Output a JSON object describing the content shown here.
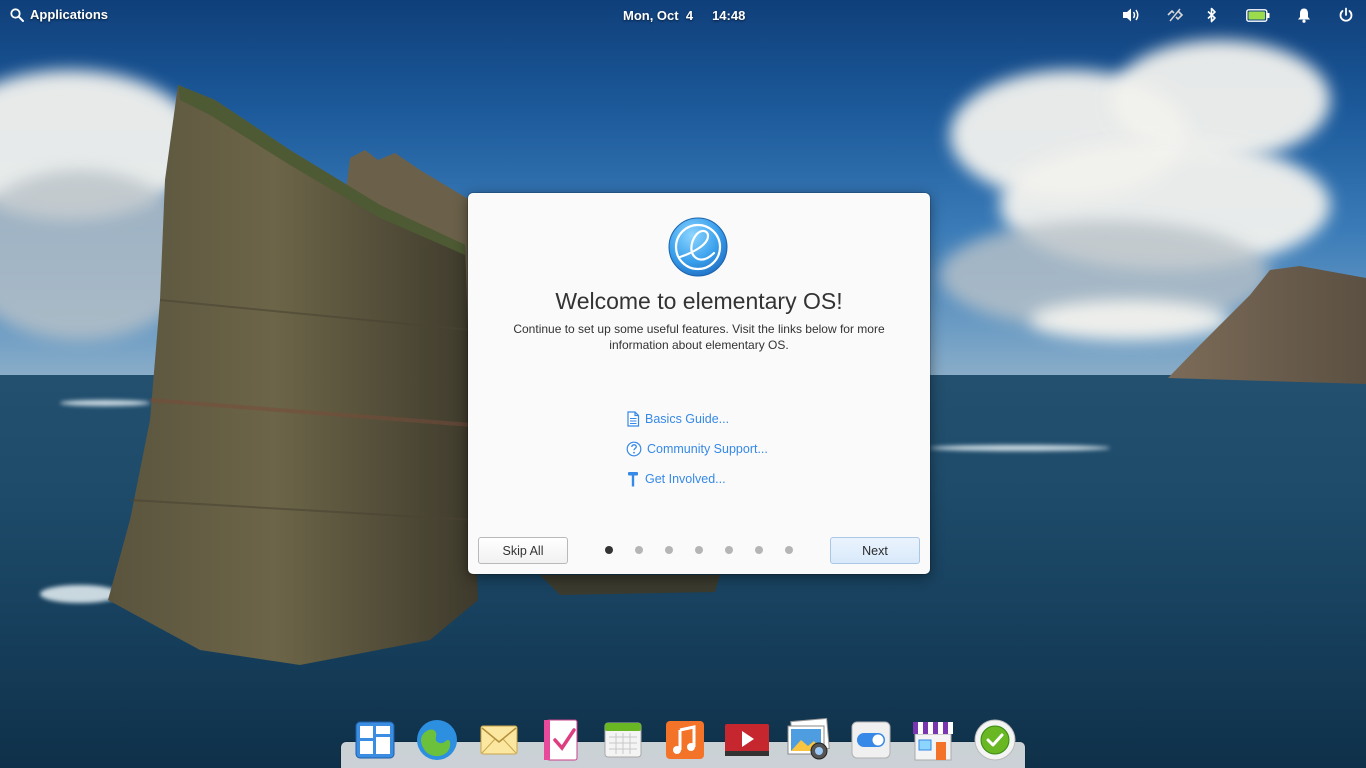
{
  "panel": {
    "applications_label": "Applications",
    "date": "Mon, Oct  4",
    "time": "14:48",
    "indicators": [
      "volume-icon",
      "network-icon",
      "bluetooth-icon",
      "battery-icon",
      "notifications-icon",
      "power-icon"
    ]
  },
  "dialog": {
    "title": "Welcome to elementary OS!",
    "description": "Continue to set up some useful features. Visit the links below for more information about elementary OS.",
    "links": [
      {
        "label": "Basics Guide...",
        "icon": "document-icon"
      },
      {
        "label": "Community Support...",
        "icon": "help-icon"
      },
      {
        "label": "Get Involved...",
        "icon": "hammer-icon"
      }
    ],
    "skip_label": "Skip All",
    "next_label": "Next",
    "pages_total": 7,
    "current_page": 1
  },
  "dock": {
    "apps": [
      "multitasking-view-icon",
      "web-browser-icon",
      "mail-icon",
      "tasks-icon",
      "calendar-icon",
      "music-icon",
      "videos-icon",
      "photos-icon",
      "system-settings-icon",
      "appcenter-icon",
      "onboarding-icon"
    ]
  },
  "colors": {
    "accent": "#3689e6",
    "dialog_bg": "#fafafa",
    "active_dot": "#333333",
    "inactive_dot": "#b5b5b5"
  }
}
